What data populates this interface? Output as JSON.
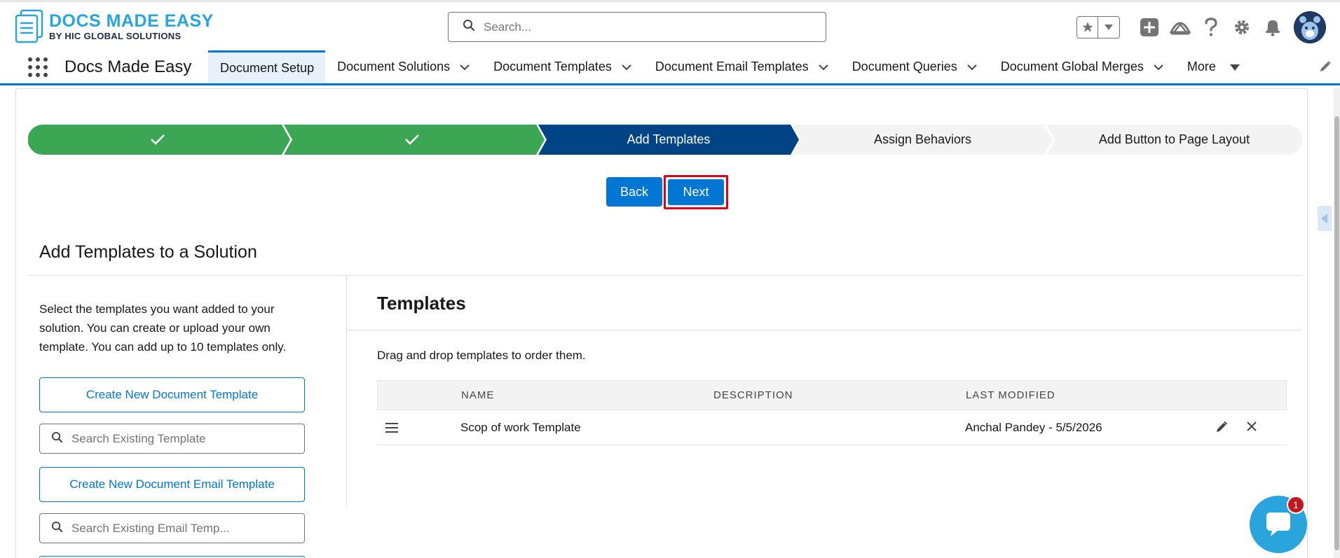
{
  "header": {
    "logo_title": "DOCS MADE EASY",
    "logo_sub": "BY HIC GLOBAL SOLUTIONS",
    "search_placeholder": "Search..."
  },
  "nav": {
    "app_name": "Docs Made Easy",
    "tabs": [
      {
        "label": "Document Setup",
        "active": true
      },
      {
        "label": "Document Solutions"
      },
      {
        "label": "Document Templates"
      },
      {
        "label": "Document Email Templates"
      },
      {
        "label": "Document Queries"
      },
      {
        "label": "Document Global Merges"
      },
      {
        "label": "More"
      }
    ]
  },
  "path": {
    "stages": [
      {
        "label": "",
        "state": "complete"
      },
      {
        "label": "",
        "state": "complete"
      },
      {
        "label": "Add Templates",
        "state": "current"
      },
      {
        "label": "Assign Behaviors",
        "state": "incomplete"
      },
      {
        "label": "Add Button to Page Layout",
        "state": "incomplete"
      }
    ]
  },
  "actions": {
    "back_label": "Back",
    "next_label": "Next"
  },
  "section": {
    "title": "Add Templates to a Solution",
    "instructions": "Select the templates you want added to your solution. You can create or upload your own template. You can add up to 10 templates only.",
    "create_template_label": "Create New Document Template",
    "search_template_placeholder": "Search Existing Template",
    "create_email_template_label": "Create New Document Email Template",
    "search_email_placeholder": "Search Existing Email Temp..."
  },
  "templates": {
    "title": "Templates",
    "hint": "Drag and drop templates to order them.",
    "columns": [
      "NAME",
      "DESCRIPTION",
      "LAST MODIFIED"
    ],
    "rows": [
      {
        "name": "Scop of work Template",
        "description": "",
        "last_modified": "Anchal Pandey - 5/5/2026"
      }
    ]
  },
  "chat": {
    "badge": "1"
  },
  "colors": {
    "complete": "#3ba755",
    "current": "#014486",
    "incomplete": "#f3f3f3",
    "brand": "#0176d3",
    "highlight": "#e0001b"
  }
}
